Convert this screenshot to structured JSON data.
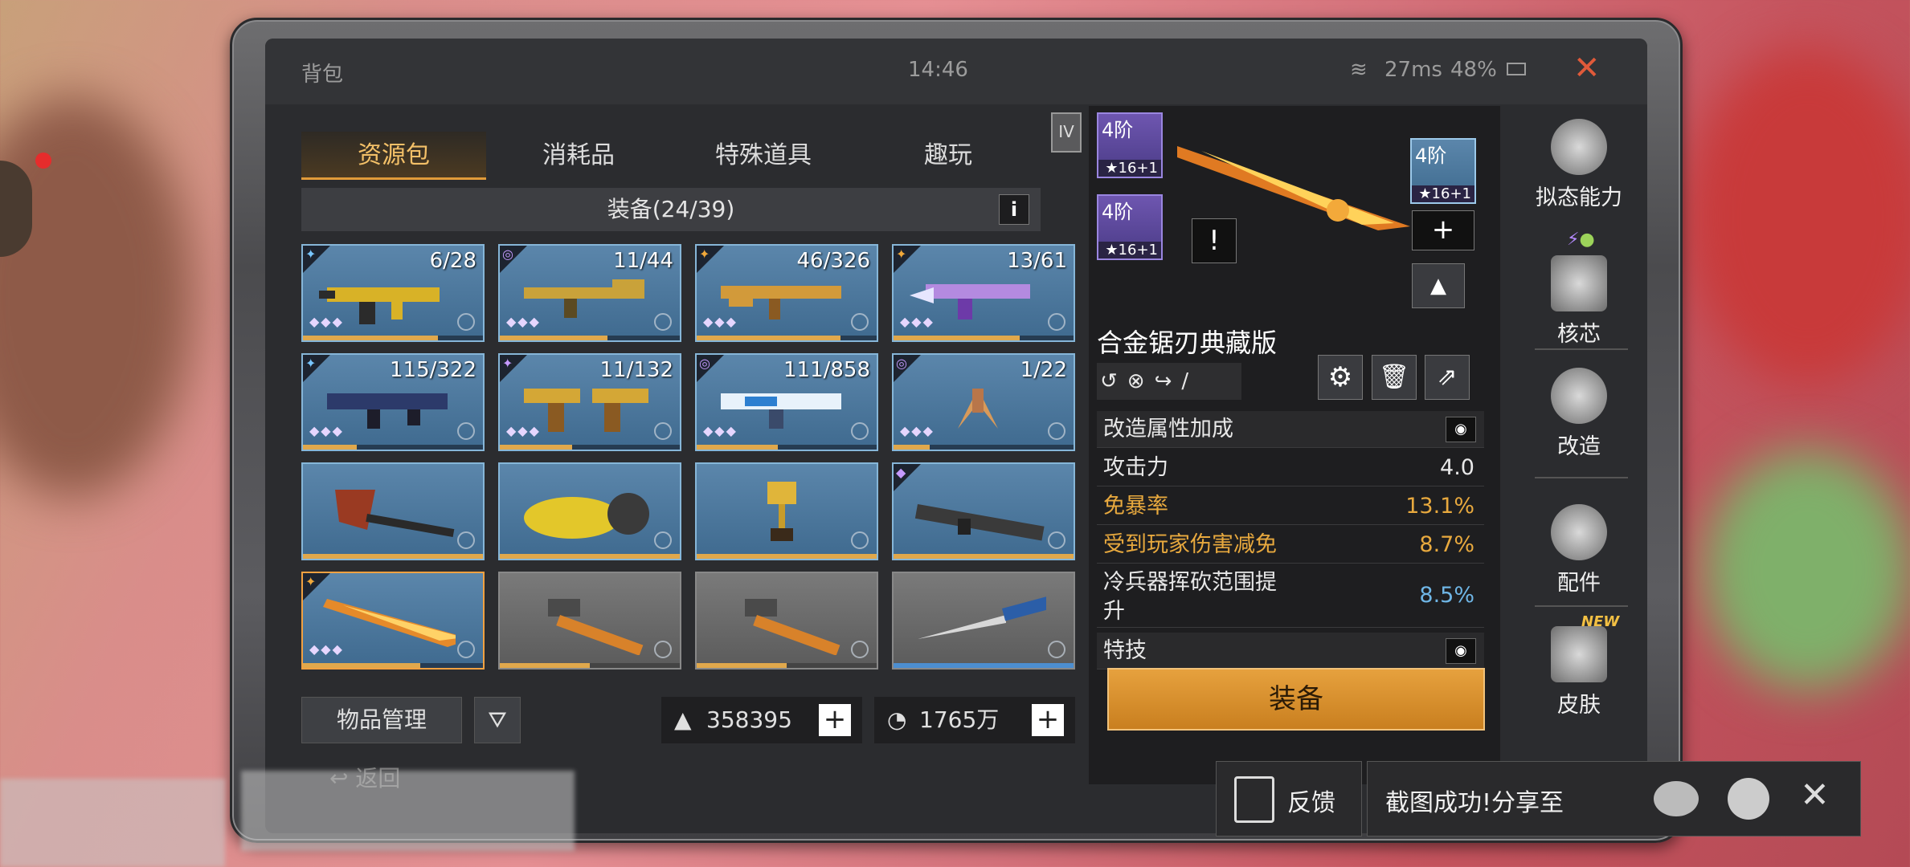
{
  "status": {
    "title": "背包",
    "time": "14:46",
    "ping": "27ms",
    "battery": "48%"
  },
  "tabs": [
    "资源包",
    "消耗品",
    "特殊道具",
    "趣玩"
  ],
  "equip_header": "装备(24/39)",
  "info_label": "i",
  "tier_badge": "IV",
  "items": [
    {
      "count": "6/28",
      "dots": "◆◆◆"
    },
    {
      "count": "11/44",
      "dots": "◆◆◆"
    },
    {
      "count": "46/326",
      "dots": "◆◆◆"
    },
    {
      "count": "13/61",
      "dots": "◆◆◆"
    },
    {
      "count": "115/322",
      "dots": "◆◆◆"
    },
    {
      "count": "11/132",
      "dots": "◆◆◆"
    },
    {
      "count": "111/858",
      "dots": "◆◆◆"
    },
    {
      "count": "1/22",
      "dots": "◆◆◆"
    },
    {
      "count": "",
      "dots": ""
    },
    {
      "count": "",
      "dots": ""
    },
    {
      "count": "",
      "dots": ""
    },
    {
      "count": "",
      "dots": ""
    },
    {
      "count": "",
      "dots": "◆◆◆"
    },
    {
      "count": "",
      "dots": ""
    },
    {
      "count": "",
      "dots": ""
    },
    {
      "count": "",
      "dots": ""
    }
  ],
  "bottom": {
    "manage": "物品管理",
    "currency1": "358395",
    "currency2": "1765万",
    "plus": "+",
    "back": "返回"
  },
  "detail": {
    "badges": [
      {
        "tier": "4阶",
        "stars": "16+1"
      },
      {
        "tier": "4阶",
        "stars": "16+1"
      },
      {
        "tier": "4阶",
        "stars": "16+1"
      }
    ],
    "warn": "!",
    "plus": "+",
    "name": "合金锯刃典藏版",
    "section_mod": "改造属性加成",
    "stats": [
      {
        "label": "攻击力",
        "value": "4.0",
        "color": "#ffffff"
      },
      {
        "label": "免暴率",
        "value": "13.1%",
        "color": "#e8a93e"
      },
      {
        "label": "受到玩家伤害减免",
        "value": "8.7%",
        "color": "#e8a93e"
      },
      {
        "label": "冷兵器挥砍范围提升",
        "value": "8.5%",
        "color": "#6fb6e6"
      }
    ],
    "section_skill": "特技",
    "equip_button": "装备"
  },
  "side_menu": [
    "拟态能力",
    "核芯",
    "改造",
    "配件",
    "皮肤"
  ],
  "new_badge": "NEW",
  "toast": {
    "feedback": "反馈",
    "share": "截图成功!分享至",
    "close": "✕"
  }
}
